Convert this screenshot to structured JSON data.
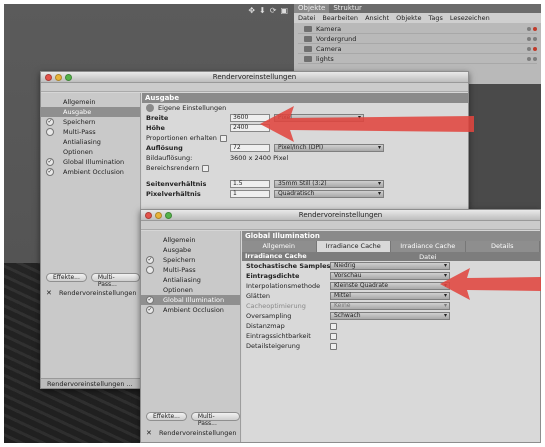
{
  "object_manager": {
    "tabs": [
      "Objekte",
      "Struktur"
    ],
    "menu": [
      "Datei",
      "Bearbeiten",
      "Ansicht",
      "Objekte",
      "Tags",
      "Lesezeichen"
    ],
    "objects": [
      {
        "name": "Kamera"
      },
      {
        "name": "Vordergrund"
      },
      {
        "name": "Camera"
      },
      {
        "name": "lights"
      }
    ]
  },
  "back_window": {
    "title": "Rendervoreinstellungen",
    "sidebar": [
      "Allgemein",
      "Ausgabe",
      "Speichern",
      "Multi-Pass",
      "Antialiasing",
      "Optionen",
      "Global Illumination",
      "Ambient Occlusion"
    ],
    "checked": [
      false,
      false,
      true,
      false,
      false,
      false,
      true,
      true
    ],
    "effects_button": "Effekte...",
    "multipass_button": "Multi-Pass...",
    "preset_label": "Rendervoreinstellungen",
    "footer_label": "Rendervoreinstellungen ...",
    "section": "Ausgabe",
    "eigene": "Eigene Einstellungen",
    "breite_label": "Breite",
    "breite_value": "3600",
    "breite_unit": "Pixel",
    "hoehe_label": "Höhe",
    "hoehe_value": "2400",
    "proportionen_label": "Proportionen erhalten",
    "aufloesung_label": "Auflösung",
    "aufloesung_value": "72",
    "aufloesung_unit": "Pixel/Inch (DPI)",
    "bildaufloesung_label": "Bildauflösung:",
    "bildaufloesung_value": "3600 x 2400 Pixel",
    "bereich_label": "Bereichsrendern",
    "seitenverhaeltnis_label": "Seitenverhältnis",
    "seitenverhaeltnis_value": "1.5",
    "seitenverhaeltnis_preset": "35mm Still (3:2)",
    "pixelverhaeltnis_label": "Pixelverhältnis",
    "pixelverhaeltnis_value": "1",
    "pixelverhaeltnis_preset": "Quadratisch"
  },
  "front_window": {
    "title": "Rendervoreinstellungen",
    "sidebar": [
      "Allgemein",
      "Ausgabe",
      "Speichern",
      "Multi-Pass",
      "Antialiasing",
      "Optionen",
      "Global Illumination",
      "Ambient Occlusion"
    ],
    "checked": [
      false,
      false,
      true,
      false,
      false,
      false,
      true,
      true
    ],
    "selected_index": 6,
    "effects_button": "Effekte...",
    "multipass_button": "Multi-Pass...",
    "preset_label": "Rendervoreinstellungen",
    "section": "Global Illumination",
    "tabs": [
      "Allgemein",
      "Irradiance Cache",
      "Irradiance Cache Datei",
      "Details"
    ],
    "active_tab": 1,
    "subsection": "Irradiance Cache",
    "rows": [
      {
        "label": "Stochastische Samples",
        "bold": true,
        "value": "Niedrig"
      },
      {
        "label": "Eintragsdichte",
        "bold": true,
        "value": "Vorschau"
      },
      {
        "label": "Interpolationsmethode",
        "value": "Kleinste Quadrate"
      },
      {
        "label": "Glätten",
        "value": "Mittel"
      },
      {
        "label": "Cacheoptimierung",
        "dim": true,
        "value": "Keine"
      },
      {
        "label": "Oversampling",
        "value": "Schwach"
      }
    ],
    "checks": [
      "Distanzmap",
      "Eintragssichtbarkeit",
      "Detailsteigerung"
    ]
  },
  "colors": {
    "arrow": "#e0453f"
  }
}
